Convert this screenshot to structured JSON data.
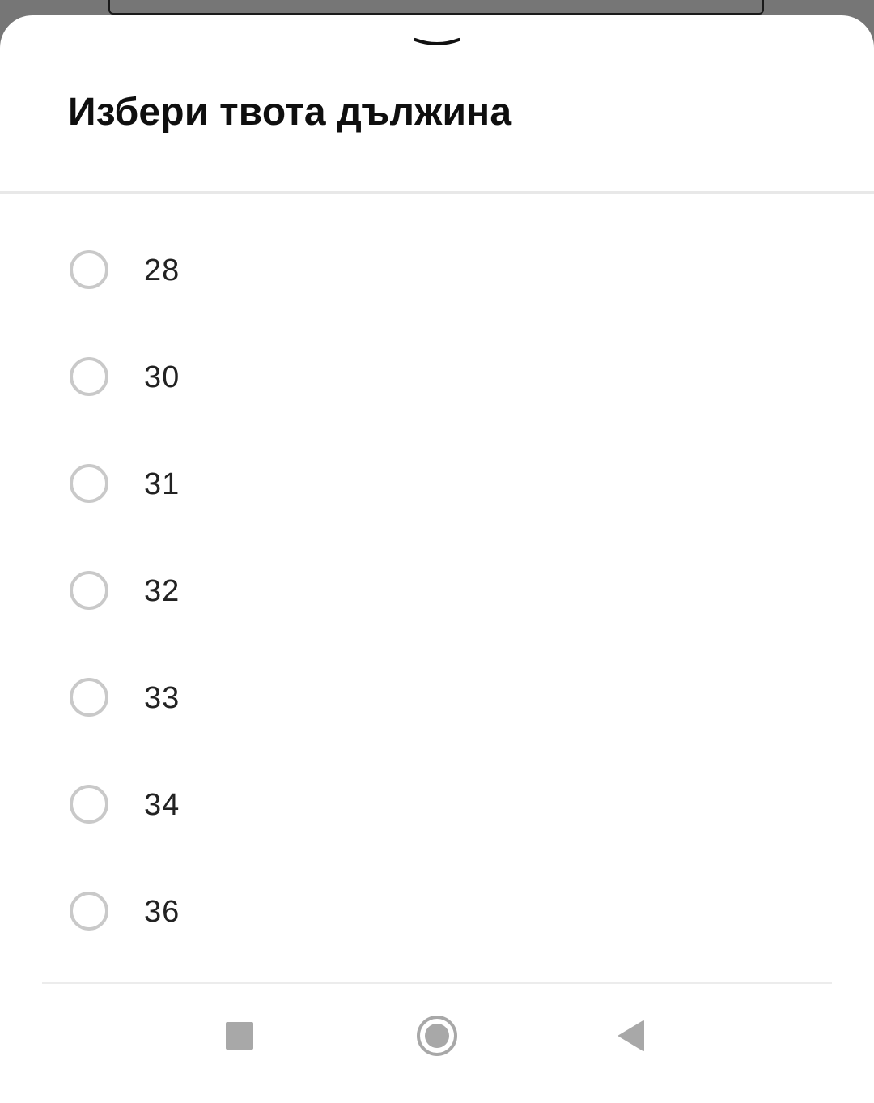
{
  "sheet": {
    "title": "Избери твота дължина",
    "handle_icon": "chevron-down-icon"
  },
  "options": [
    {
      "label": "28",
      "selected": false
    },
    {
      "label": "30",
      "selected": false
    },
    {
      "label": "31",
      "selected": false
    },
    {
      "label": "32",
      "selected": false
    },
    {
      "label": "33",
      "selected": false
    },
    {
      "label": "34",
      "selected": false
    },
    {
      "label": "36",
      "selected": false
    }
  ],
  "nav_bar": {
    "recents_icon": "square-icon",
    "home_icon": "circle-home-icon",
    "back_icon": "triangle-back-icon"
  },
  "colors": {
    "backdrop": "#767676",
    "sheet": "#ffffff",
    "radio_border": "#c9c9c9",
    "nav_icons": "#a8a8a8",
    "title_text": "#0f0f0f"
  }
}
